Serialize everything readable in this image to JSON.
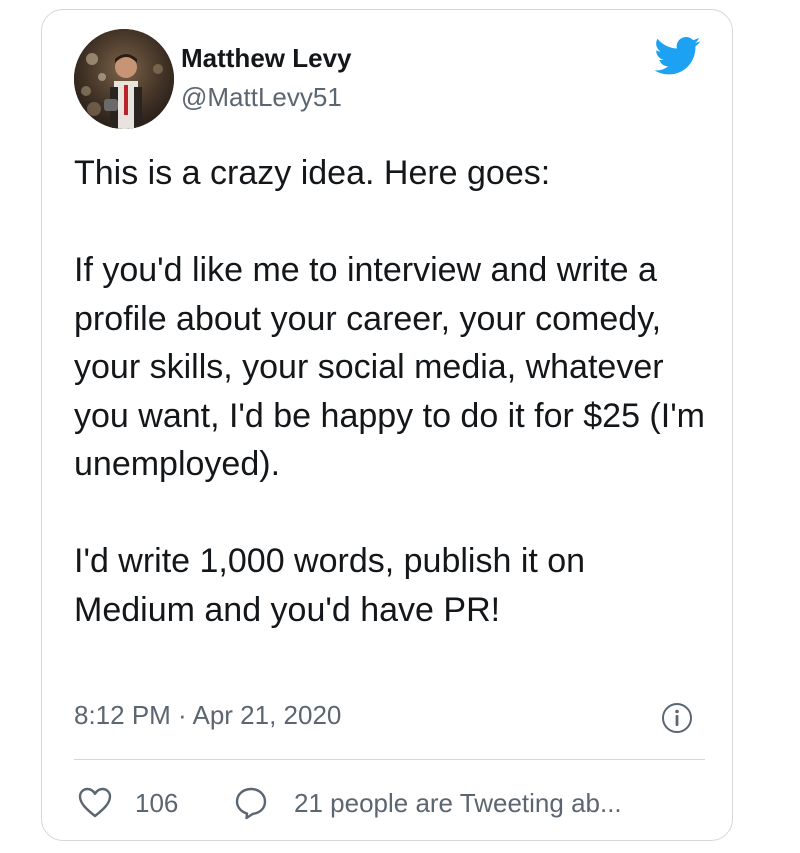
{
  "author": {
    "name": "Matthew Levy",
    "handle": "@MattLevy51"
  },
  "tweet": {
    "paragraphs": [
      "This is a crazy idea. Here goes:",
      "If you'd like me to interview and write a profile about your career, your comedy, your skills, your social media, whatever you want, I'd be happy to do it for $25 (I'm unemployed).",
      "I'd write 1,000 words, publish it on Medium and you'd have PR!"
    ],
    "timestamp": "8:12 PM · Apr 21, 2020"
  },
  "actions": {
    "likes": "106",
    "conversation": "21 people are Tweeting ab..."
  },
  "icons": {
    "brand": "twitter-bird-icon",
    "info": "info-icon",
    "like": "heart-icon",
    "reply": "reply-bubble-icon"
  },
  "colors": {
    "twitter_blue": "#1da1f2",
    "text_primary": "#14171a",
    "text_secondary": "#5b6670",
    "border": "#d3d7da"
  }
}
